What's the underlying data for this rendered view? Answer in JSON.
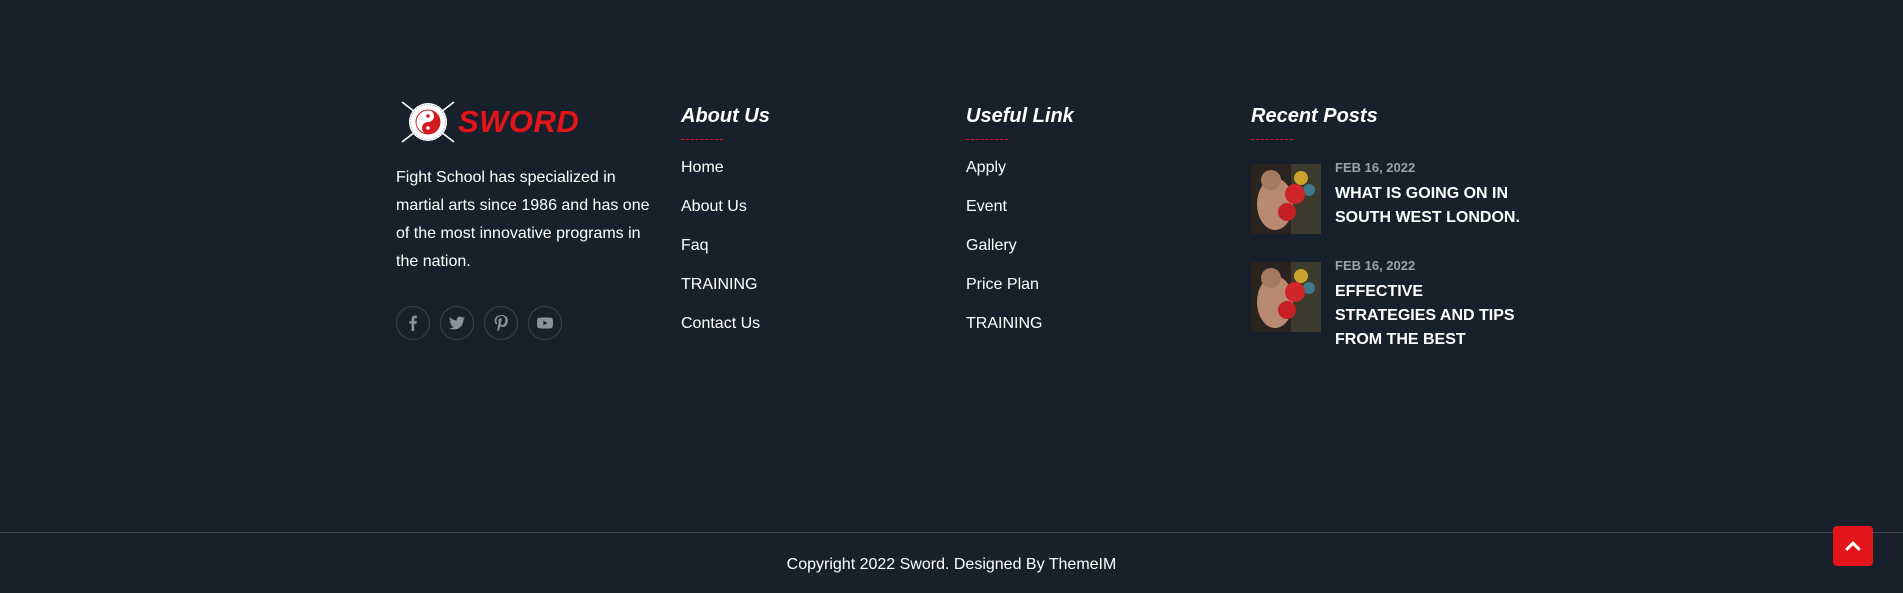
{
  "brand": {
    "name": "SWORD",
    "accent_color": "#e3151b",
    "background_color": "#18212b"
  },
  "about": {
    "description": "Fight School has specialized in martial arts since 1986 and has one of the most innovative programs in the nation.",
    "social": [
      {
        "icon": "facebook-icon"
      },
      {
        "icon": "twitter-icon"
      },
      {
        "icon": "pinterest-icon"
      },
      {
        "icon": "youtube-icon"
      }
    ]
  },
  "about_us": {
    "title": "About Us",
    "links": [
      "Home",
      "About Us",
      "Faq",
      "TRAINING",
      "Contact Us"
    ]
  },
  "useful_link": {
    "title": "Useful Link",
    "links": [
      "Apply",
      "Event",
      "Gallery",
      "Price Plan",
      "TRAINING"
    ]
  },
  "recent_posts": {
    "title": "Recent Posts",
    "posts": [
      {
        "date": "FEB 16, 2022",
        "title": "WHAT IS GOING ON IN SOUTH WEST LONDON."
      },
      {
        "date": "FEB 16, 2022",
        "title": "EFFECTIVE STRATEGIES AND TIPS FROM THE BEST"
      }
    ]
  },
  "footer": {
    "copyright": "Copyright 2022 Sword. Designed By ThemeIM"
  },
  "scroll_top": {
    "icon": "chevron-up-icon"
  }
}
